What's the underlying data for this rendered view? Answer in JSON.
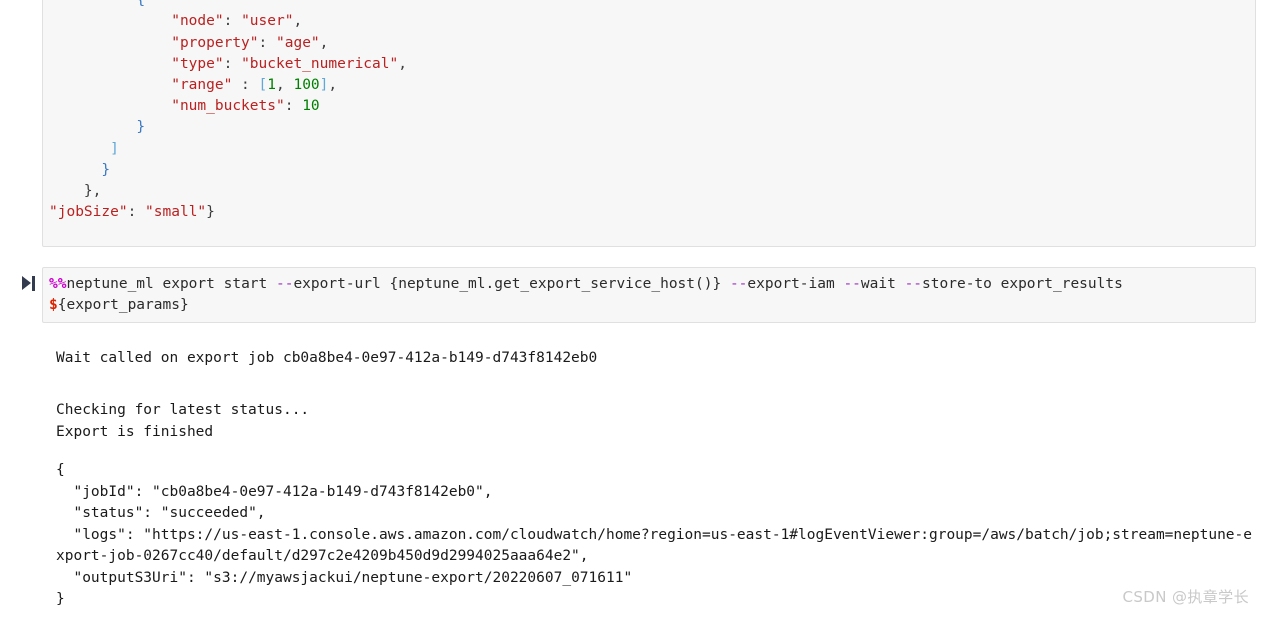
{
  "notebook": {
    "json_cell": {
      "name": "export-params-json-cell",
      "lines": [
        [
          {
            "t": "          ",
            "c": "plain"
          },
          {
            "t": "}",
            "c": "p1"
          },
          {
            "t": ",",
            "c": "p0"
          }
        ],
        [
          {
            "t": "          ",
            "c": "plain"
          },
          {
            "t": "{",
            "c": "p1"
          }
        ],
        [
          {
            "t": "              ",
            "c": "plain"
          },
          {
            "t": "\"node\"",
            "c": "s"
          },
          {
            "t": ": ",
            "c": "p0"
          },
          {
            "t": "\"user\"",
            "c": "s"
          },
          {
            "t": ",",
            "c": "p0"
          }
        ],
        [
          {
            "t": "              ",
            "c": "plain"
          },
          {
            "t": "\"property\"",
            "c": "s"
          },
          {
            "t": ": ",
            "c": "p0"
          },
          {
            "t": "\"age\"",
            "c": "s"
          },
          {
            "t": ",",
            "c": "p0"
          }
        ],
        [
          {
            "t": "              ",
            "c": "plain"
          },
          {
            "t": "\"type\"",
            "c": "s"
          },
          {
            "t": ": ",
            "c": "p0"
          },
          {
            "t": "\"bucket_numerical\"",
            "c": "s"
          },
          {
            "t": ",",
            "c": "p0"
          }
        ],
        [
          {
            "t": "              ",
            "c": "plain"
          },
          {
            "t": "\"range\"",
            "c": "s"
          },
          {
            "t": " : ",
            "c": "p0"
          },
          {
            "t": "[",
            "c": "p2"
          },
          {
            "t": "1",
            "c": "n"
          },
          {
            "t": ", ",
            "c": "p0"
          },
          {
            "t": "100",
            "c": "n"
          },
          {
            "t": "]",
            "c": "p2"
          },
          {
            "t": ",",
            "c": "p0"
          }
        ],
        [
          {
            "t": "              ",
            "c": "plain"
          },
          {
            "t": "\"num_buckets\"",
            "c": "s"
          },
          {
            "t": ": ",
            "c": "p0"
          },
          {
            "t": "10",
            "c": "n"
          }
        ],
        [
          {
            "t": "          ",
            "c": "plain"
          },
          {
            "t": "}",
            "c": "p1"
          }
        ],
        [
          {
            "t": "       ",
            "c": "plain"
          },
          {
            "t": "]",
            "c": "p2"
          }
        ],
        [
          {
            "t": "      ",
            "c": "plain"
          },
          {
            "t": "}",
            "c": "p1"
          }
        ],
        [
          {
            "t": "    ",
            "c": "plain"
          },
          {
            "t": "}",
            "c": "p0"
          },
          {
            "t": ",",
            "c": "p0"
          }
        ],
        [
          {
            "t": "\"jobSize\"",
            "c": "s"
          },
          {
            "t": ": ",
            "c": "p0"
          },
          {
            "t": "\"small\"",
            "c": "s"
          },
          {
            "t": "}",
            "c": "p0"
          }
        ]
      ]
    },
    "command_cell": {
      "name": "neptune-ml-export-start-cell",
      "run_marker_icon": "play-to-end-icon",
      "lines": [
        [
          {
            "t": "%%",
            "c": "magic"
          },
          {
            "t": "neptune_ml export start ",
            "c": "plain"
          },
          {
            "t": "--",
            "c": "flag"
          },
          {
            "t": "export-url {neptune_ml.get_export_service_host()} ",
            "c": "plain"
          },
          {
            "t": "--",
            "c": "flag"
          },
          {
            "t": "export-iam ",
            "c": "plain"
          },
          {
            "t": "--",
            "c": "flag"
          },
          {
            "t": "wait ",
            "c": "plain"
          },
          {
            "t": "--",
            "c": "flag"
          },
          {
            "t": "store-to export_results",
            "c": "plain"
          }
        ],
        [
          {
            "t": "$",
            "c": "var"
          },
          {
            "t": "{export_params}",
            "c": "plain"
          }
        ]
      ]
    },
    "output": {
      "wait_message": "Wait called on export job cb0a8be4-0e97-412a-b149-d743f8142eb0",
      "status_lines": "Checking for latest status...\nExport is finished",
      "result_json": "{\n  \"jobId\": \"cb0a8be4-0e97-412a-b149-d743f8142eb0\",\n  \"status\": \"succeeded\",\n  \"logs\": \"https://us-east-1.console.aws.amazon.com/cloudwatch/home?region=us-east-1#logEventViewer:group=/aws/batch/job;stream=neptune-export-job-0267cc40/default/d297c2e4209b450d9d2994025aaa64e2\",\n  \"outputS3Uri\": \"s3://myawsjackui/neptune-export/20220607_071611\"\n}"
    }
  },
  "watermark": {
    "text": "CSDN @执章学长"
  }
}
